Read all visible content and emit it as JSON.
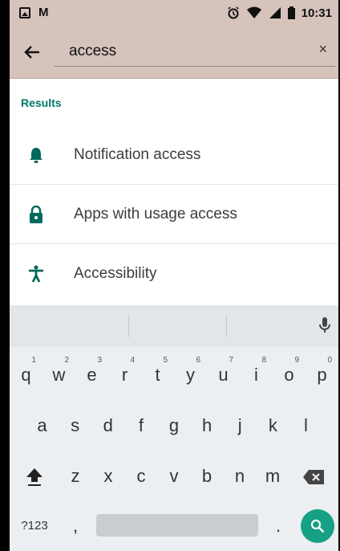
{
  "status_bar": {
    "time": "10:31"
  },
  "search": {
    "query": "access",
    "clear_glyph": "×"
  },
  "results": {
    "label": "Results",
    "items": [
      {
        "label": "Notification access",
        "icon": "bell-icon"
      },
      {
        "label": "Apps with usage access",
        "icon": "lock-icon"
      },
      {
        "label": "Accessibility",
        "icon": "accessibility-icon"
      }
    ]
  },
  "keyboard": {
    "row1": [
      {
        "k": "q",
        "n": "1"
      },
      {
        "k": "w",
        "n": "2"
      },
      {
        "k": "e",
        "n": "3"
      },
      {
        "k": "r",
        "n": "4"
      },
      {
        "k": "t",
        "n": "5"
      },
      {
        "k": "y",
        "n": "6"
      },
      {
        "k": "u",
        "n": "7"
      },
      {
        "k": "i",
        "n": "8"
      },
      {
        "k": "o",
        "n": "9"
      },
      {
        "k": "p",
        "n": "0"
      }
    ],
    "row2": [
      "a",
      "s",
      "d",
      "f",
      "g",
      "h",
      "j",
      "k",
      "l"
    ],
    "row3": [
      "z",
      "x",
      "c",
      "v",
      "b",
      "n",
      "m"
    ],
    "symbols_label": "?123",
    "comma": ",",
    "period": "."
  },
  "colors": {
    "accent": "#00796b",
    "header": "#d6c3bb",
    "search_key": "#16a085"
  }
}
